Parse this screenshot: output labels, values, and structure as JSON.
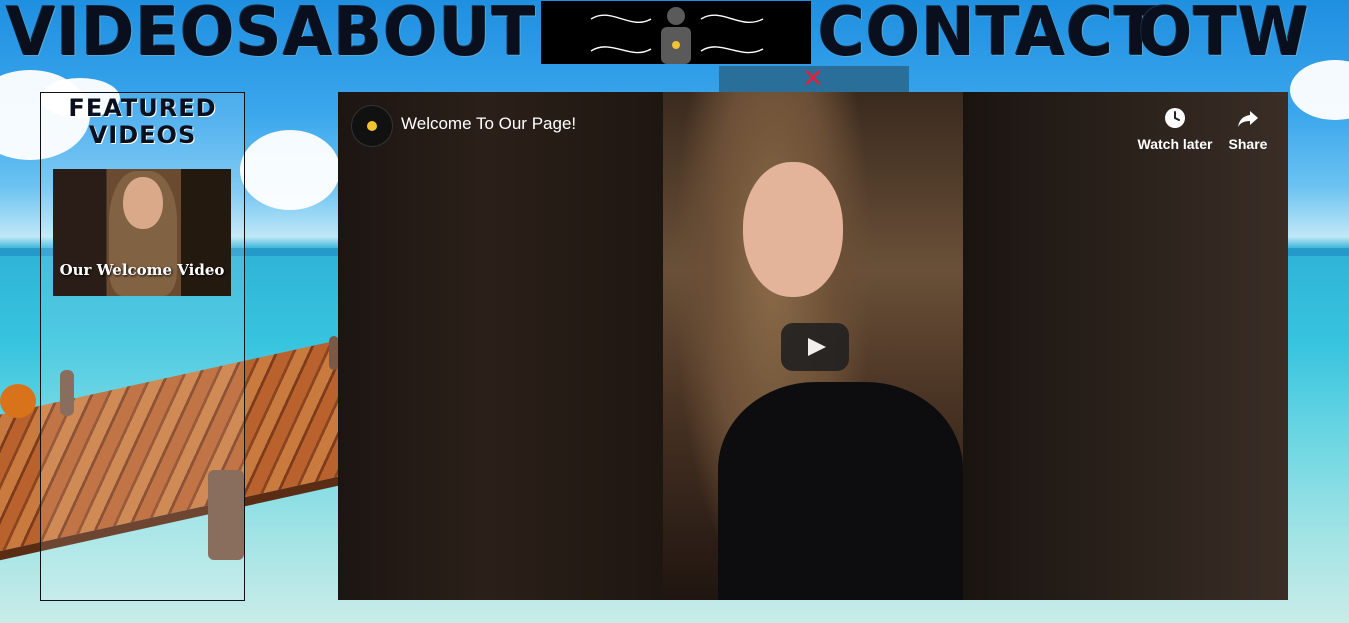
{
  "nav": {
    "videos": "VIDEOS",
    "about": "ABOUT",
    "contact": "CONTACT",
    "otw": "OTW"
  },
  "featured": {
    "title": "FEATURED VIDEOS",
    "thumb_label": "Our Welcome Video"
  },
  "player": {
    "title": "Welcome To Our Page!",
    "watch_later": "Watch later",
    "share": "Share"
  },
  "icons": {
    "close": "close-icon",
    "logo": "logo-icon",
    "clock": "clock-icon",
    "share": "share-icon",
    "play": "play-icon"
  },
  "colors": {
    "close_x": "#e0213a",
    "logo_accent": "#f2c230"
  }
}
